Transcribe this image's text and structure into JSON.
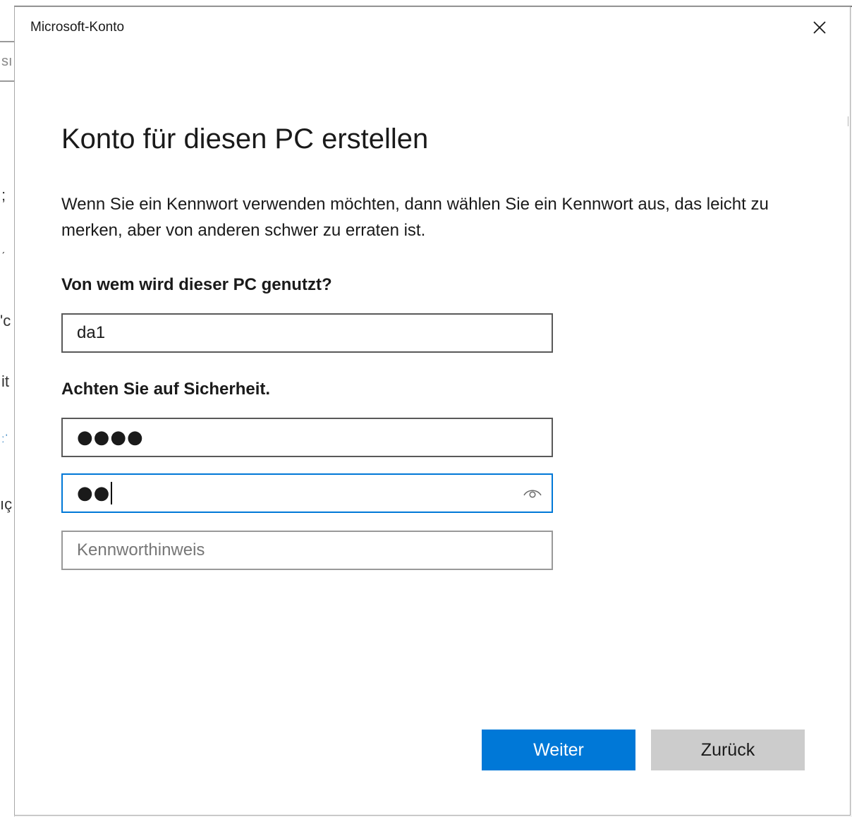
{
  "window": {
    "title": "Microsoft-Konto",
    "close_icon": "close-icon"
  },
  "background": {
    "fragments": [
      "sı",
      ";",
      "ˊ",
      "'c",
      "it",
      "ːˈ",
      "ıç"
    ]
  },
  "main": {
    "heading": "Konto für diesen PC erstellen",
    "description": "Wenn Sie ein Kennwort verwenden möchten, dann wählen Sie ein Kennwort aus, das leicht zu merken, aber von anderen schwer zu erraten ist.",
    "user_section_label": "Von wem wird dieser PC genutzt?",
    "username_value": "da1",
    "security_section_label": "Achten Sie auf Sicherheit.",
    "password_masked": "●●●●",
    "password_confirm_masked": "●●",
    "password_hint_placeholder": "Kennworthinweis",
    "reveal_icon": "eye-icon"
  },
  "footer": {
    "next_label": "Weiter",
    "back_label": "Zurück"
  },
  "colors": {
    "accent": "#0078d7",
    "secondary_button": "#cccccc"
  }
}
